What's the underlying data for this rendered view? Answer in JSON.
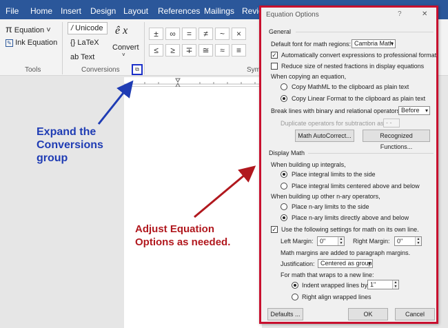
{
  "ribbon": {
    "tabs": [
      "File",
      "Home",
      "Insert",
      "Design",
      "Layout",
      "References",
      "Mailings",
      "Revie"
    ],
    "tools": {
      "equation": "Equation",
      "ink_equation": "Ink Equation",
      "label": "Tools"
    },
    "conversions": {
      "unicode": "Unicode",
      "latex": "LaTeX",
      "text": "Text",
      "convert": "Convert",
      "label": "Conversions"
    },
    "symbols_label": "Sym",
    "symbols": [
      "±",
      "∞",
      "=",
      "≠",
      "~",
      "×",
      "≤",
      "≥",
      "∓",
      "≅",
      "≈",
      "≡"
    ]
  },
  "annotations": {
    "blue": "Expand the Conversions group",
    "red": "Adjust Equation Options as needed."
  },
  "dialog": {
    "title": "Equation Options",
    "help": "?",
    "close": "✕",
    "general": "General",
    "default_font_label": "Default font for math regions:",
    "default_font_value": "Cambria Math",
    "auto_convert": "Automatically convert expressions to professional format",
    "reduce_size": "Reduce size of nested fractions in display equations",
    "copying_label": "When copying an equation,",
    "copy_mathml": "Copy MathML to the clipboard as plain text",
    "copy_linear": "Copy Linear Format to the clipboard as plain text",
    "break_lines_label": "Break lines with binary and relational operators:",
    "break_lines_value": "Before",
    "duplicate_label": "Duplicate operators for subtraction as:",
    "duplicate_value": "- -",
    "math_autocorrect": "Math AutoCorrect...",
    "recognized_functions": "Recognized Functions...",
    "display_math": "Display Math",
    "integrals_label": "When building up integrals,",
    "integral_side": "Place integral limits to the side",
    "integral_centered": "Place integral limits centered above and below",
    "nary_label": "When building up other n-ary operators,",
    "nary_side": "Place n-ary limits to the side",
    "nary_above": "Place n-ary limits directly above and below",
    "use_settings": "Use the following settings for math on its own line.",
    "left_margin_label": "Left Margin:",
    "left_margin_value": "0\"",
    "right_margin_label": "Right Margin:",
    "right_margin_value": "0\"",
    "margins_note": "Math margins are added to paragraph margins.",
    "justification_label": "Justification:",
    "justification_value": "Centered as group",
    "wraps_label": "For math that wraps to a new line:",
    "indent_label": "Indent wrapped lines by:",
    "indent_value": "1\"",
    "right_align": "Right align wrapped lines",
    "defaults": "Defaults ...",
    "ok": "OK",
    "cancel": "Cancel"
  },
  "colors": {
    "ribbon_blue": "#2b579a",
    "annotation_blue": "#1f3cb4",
    "annotation_red": "#b1181e",
    "highlight_border": "#c8102e"
  }
}
